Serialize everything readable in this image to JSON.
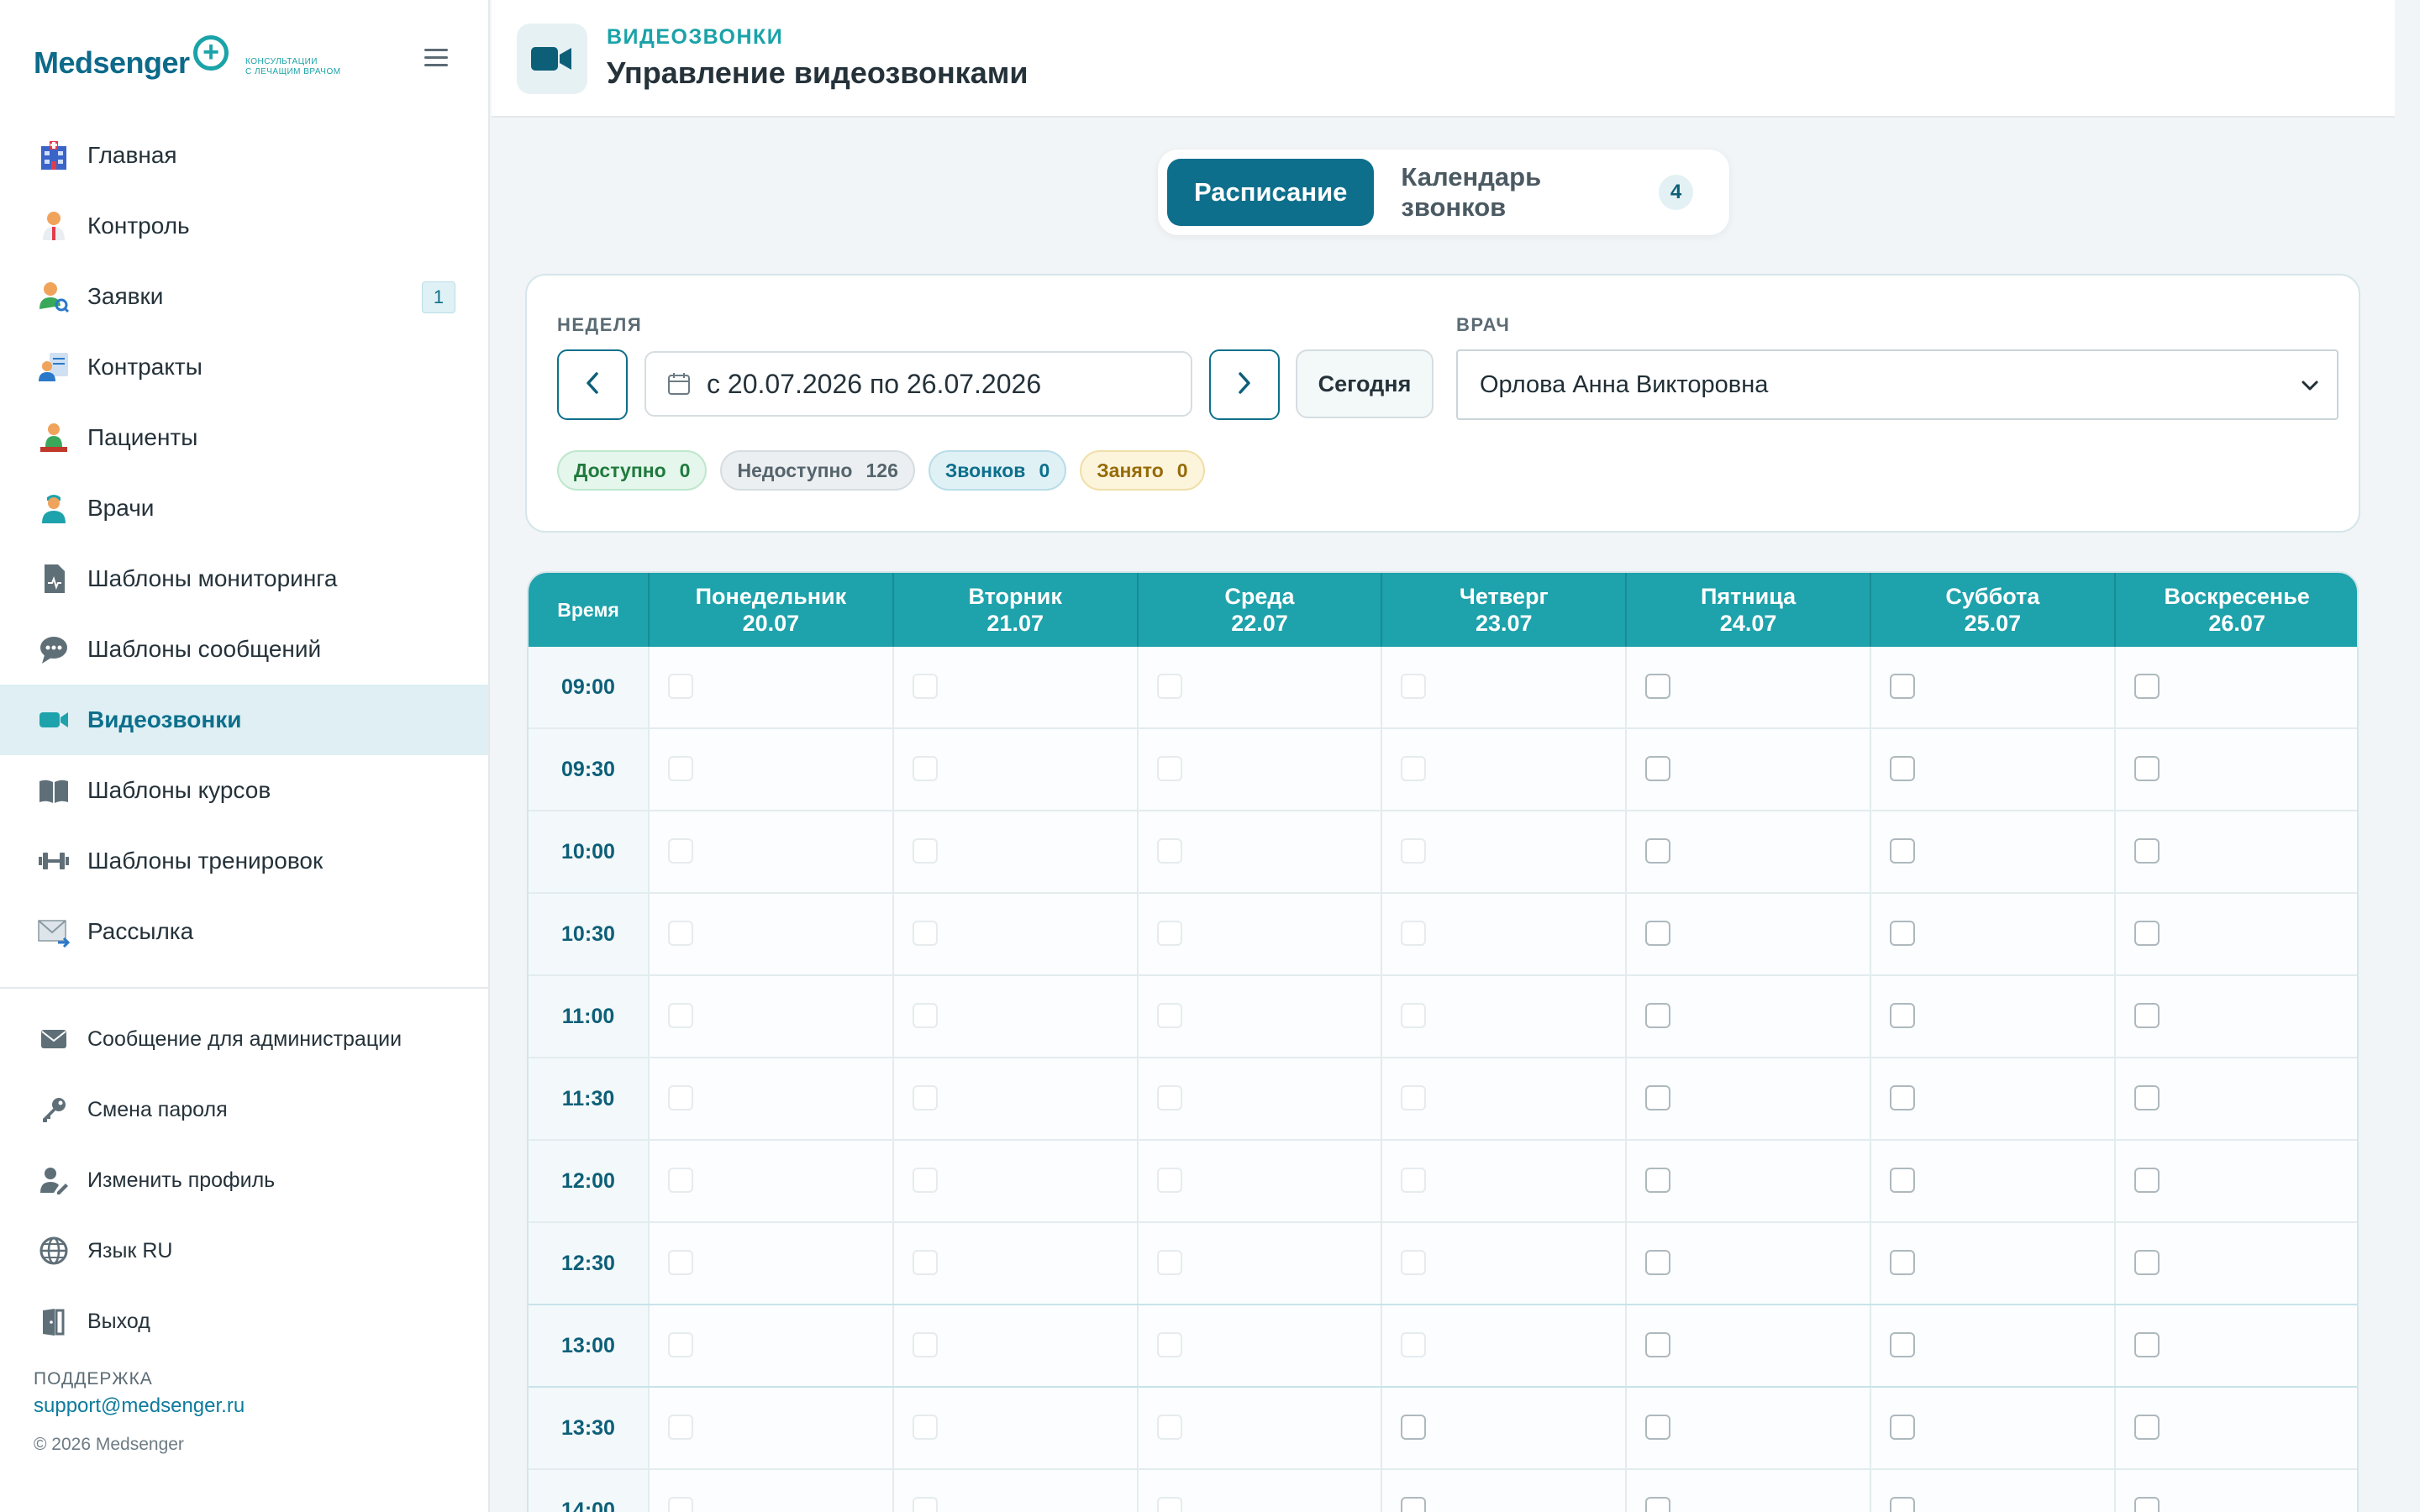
{
  "brand": {
    "name": "Medsenger",
    "tagline_line1": "консультации",
    "tagline_line2": "с лечащим врачом"
  },
  "sidebar": {
    "items": [
      {
        "label": "Главная",
        "icon": "hospital-icon"
      },
      {
        "label": "Контроль",
        "icon": "doctor-icon"
      },
      {
        "label": "Заявки",
        "icon": "user-search-icon",
        "badge": "1"
      },
      {
        "label": "Контракты",
        "icon": "contract-icon"
      },
      {
        "label": "Пациенты",
        "icon": "patient-icon"
      },
      {
        "label": "Врачи",
        "icon": "doctors-icon"
      },
      {
        "label": "Шаблоны мониторинга",
        "icon": "monitoring-template-icon"
      },
      {
        "label": "Шаблоны сообщений",
        "icon": "message-template-icon"
      },
      {
        "label": "Видеозвонки",
        "icon": "video-camera-icon",
        "active": true
      },
      {
        "label": "Шаблоны курсов",
        "icon": "book-icon"
      },
      {
        "label": "Шаблоны тренировок",
        "icon": "dumbbell-icon"
      },
      {
        "label": "Рассылка",
        "icon": "mail-send-icon"
      }
    ],
    "bottom_items": [
      {
        "label": "Сообщение для администрации",
        "icon": "envelope-icon"
      },
      {
        "label": "Смена пароля",
        "icon": "key-icon"
      },
      {
        "label": "Изменить профиль",
        "icon": "user-edit-icon"
      },
      {
        "label": "Язык RU",
        "icon": "globe-icon"
      },
      {
        "label": "Выход",
        "icon": "logout-icon"
      }
    ],
    "support_label": "ПОДДЕРЖКА",
    "support_email": "support@medsenger.ru",
    "copyright": "© 2026 Medsenger"
  },
  "header": {
    "eyebrow": "ВИДЕОЗВОНКИ",
    "title": "Управление видеозвонками"
  },
  "tabs": [
    {
      "label": "Расписание",
      "active": true
    },
    {
      "label": "Календарь звонков",
      "count": "4"
    }
  ],
  "filters": {
    "week_label": "НЕДЕЛЯ",
    "week_value": "с 20.07.2026 по 26.07.2026",
    "today_label": "Сегодня",
    "doctor_label": "ВРАЧ",
    "doctor_value": "Орлова Анна Викторовна"
  },
  "stats": [
    {
      "label": "Доступно",
      "value": "0",
      "tone": "green"
    },
    {
      "label": "Недоступно",
      "value": "126",
      "tone": "gray"
    },
    {
      "label": "Звонков",
      "value": "0",
      "tone": "teal"
    },
    {
      "label": "Занято",
      "value": "0",
      "tone": "yellow"
    }
  ],
  "schedule": {
    "time_header": "Время",
    "days": [
      {
        "name": "Понедельник",
        "date": "20.07"
      },
      {
        "name": "Вторник",
        "date": "21.07"
      },
      {
        "name": "Среда",
        "date": "22.07"
      },
      {
        "name": "Четверг",
        "date": "23.07"
      },
      {
        "name": "Пятница",
        "date": "24.07"
      },
      {
        "name": "Суббота",
        "date": "25.07"
      },
      {
        "name": "Воскресенье",
        "date": "26.07"
      }
    ],
    "times": [
      "09:00",
      "09:30",
      "10:00",
      "10:30",
      "11:00",
      "11:30",
      "12:00",
      "12:30",
      "13:00",
      "13:30",
      "14:00"
    ]
  },
  "colors": {
    "primary": "#0d6f8c",
    "accent": "#1ea2ab",
    "active_bg": "#dfeff3"
  }
}
